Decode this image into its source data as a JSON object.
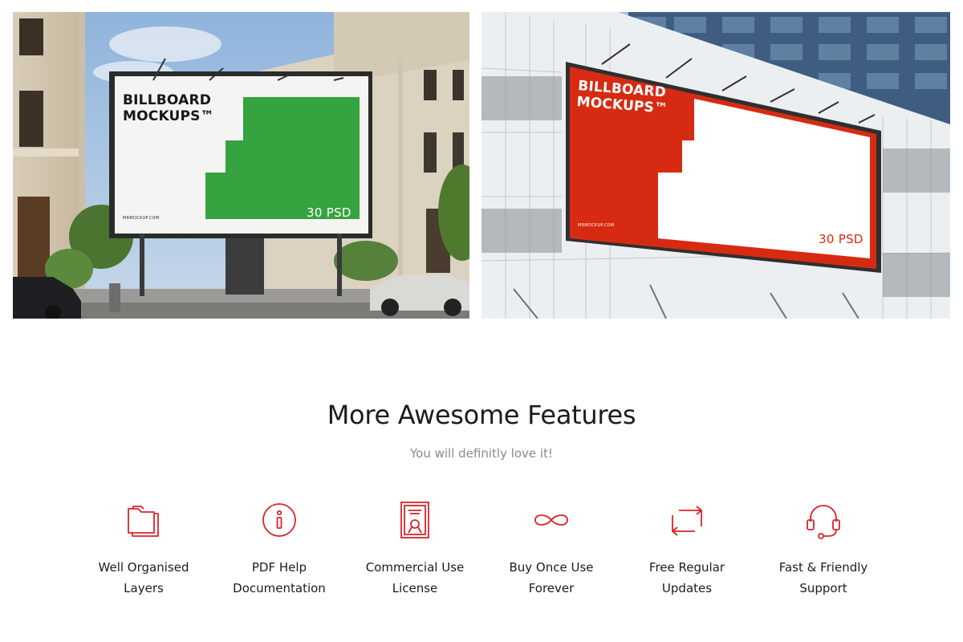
{
  "images": {
    "left": {
      "billboard_title": "BILLBOARD\nMOCKUPS™",
      "badge": "30 PSD",
      "url": "MRMOCKUP.COM",
      "accent_color": "#35a33f"
    },
    "right": {
      "billboard_title": "BILLBOARD\nMOCKUPS™",
      "badge": "30 PSD",
      "url": "MRMOCKUP.COM",
      "accent_color": "#d62b12"
    }
  },
  "features": {
    "title": "More Awesome Features",
    "subtitle": "You will definitly love it!",
    "icon_color": "#d8242a",
    "items": [
      {
        "label": "Well Organised\nLayers",
        "icon": "folder-icon"
      },
      {
        "label": "PDF Help\nDocumentation",
        "icon": "info-icon"
      },
      {
        "label": "Commercial Use\nLicense",
        "icon": "certificate-icon"
      },
      {
        "label": "Buy Once Use\nForever",
        "icon": "infinity-icon"
      },
      {
        "label": "Free Regular\nUpdates",
        "icon": "refresh-icon"
      },
      {
        "label": "Fast & Friendly\nSupport",
        "icon": "headset-icon"
      }
    ]
  }
}
